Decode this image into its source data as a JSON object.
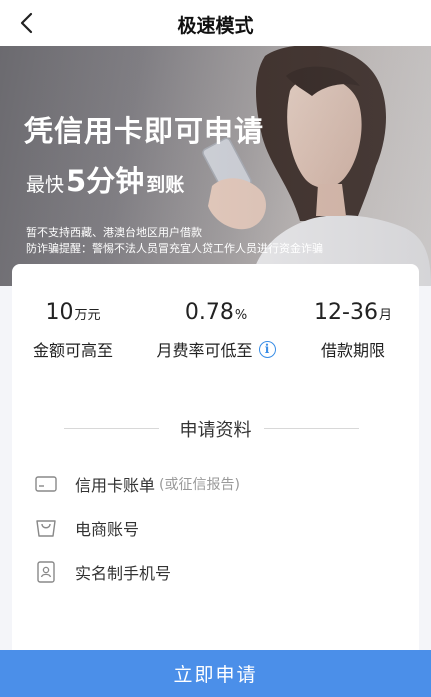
{
  "header": {
    "title": "极速模式",
    "back_icon": "chevron-left-icon"
  },
  "banner": {
    "headline": "凭信用卡即可申请",
    "sub_prefix": "最快",
    "sub_highlight": "5分钟",
    "sub_suffix": "到账",
    "note1": "暂不支持西藏、港澳台地区用户借款",
    "note2": "防诈骗提醒：警惕不法人员冒充宜人贷工作人员进行资金诈骗"
  },
  "stats": [
    {
      "value": "10",
      "unit": "万元",
      "label": "金额可高至"
    },
    {
      "value": "0.78",
      "unit": "%",
      "label": "月费率可低至",
      "icon": "info-icon"
    },
    {
      "value": "12-36",
      "unit": "月",
      "label": "借款期限"
    }
  ],
  "section": {
    "title": "申请资料"
  },
  "requirements": [
    {
      "label": "信用卡账单",
      "hint": "(或征信报告)",
      "icon": "credit-card-icon"
    },
    {
      "label": "电商账号",
      "icon": "shopping-bag-icon"
    },
    {
      "label": "实名制手机号",
      "icon": "phone-id-icon"
    }
  ],
  "cta": {
    "label": "立即申请"
  }
}
